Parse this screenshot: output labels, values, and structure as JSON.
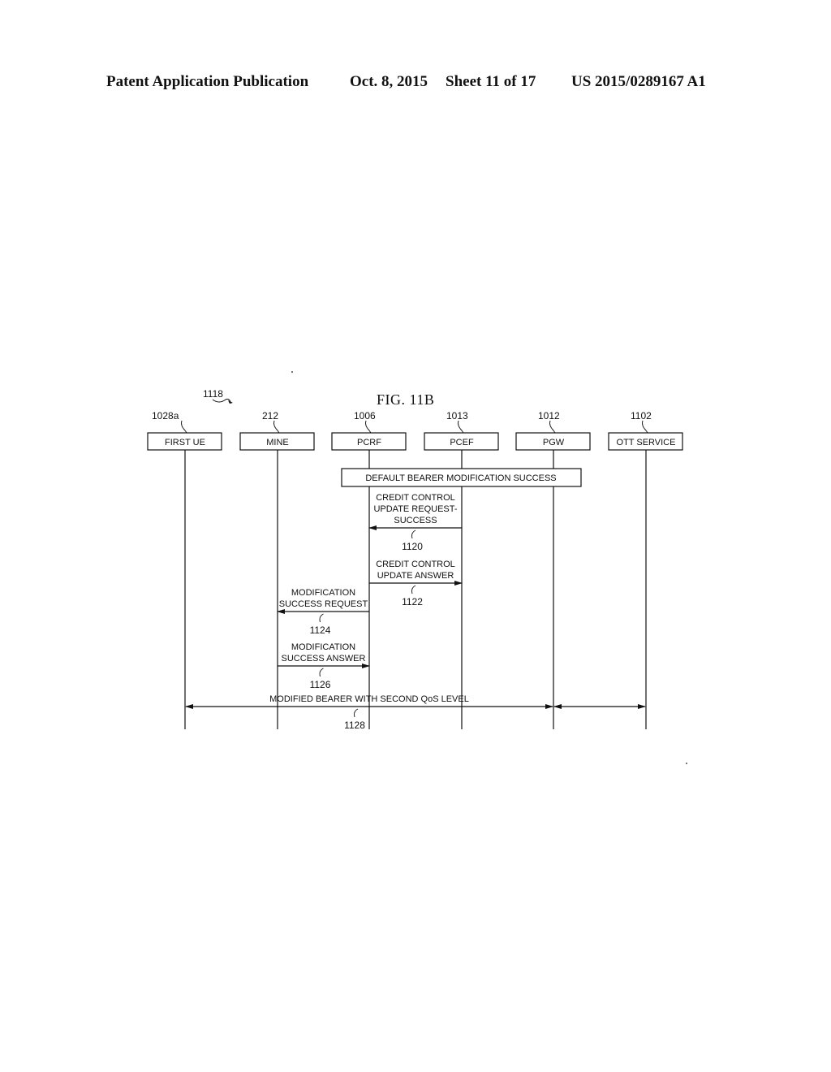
{
  "header": {
    "publication": "Patent Application Publication",
    "date": "Oct. 8, 2015",
    "sheet": "Sheet 11 of 17",
    "number": "US 2015/0289167 A1"
  },
  "figure": {
    "title": "FIG. 11B",
    "reference": "1118",
    "entities": [
      {
        "ref": "1028a",
        "label": "FIRST UE"
      },
      {
        "ref": "212",
        "label": "MINE"
      },
      {
        "ref": "1006",
        "label": "PCRF"
      },
      {
        "ref": "1013",
        "label": "PCEF"
      },
      {
        "ref": "1012",
        "label": "PGW"
      },
      {
        "ref": "1102",
        "label": "OTT SERVICE"
      }
    ],
    "span_box": {
      "label": "DEFAULT BEARER MODIFICATION SUCCESS",
      "from": 2,
      "to": 4
    },
    "messages": [
      {
        "ref": "1120",
        "lines": [
          "CREDIT CONTROL",
          "UPDATE REQUEST-",
          "SUCCESS"
        ],
        "from": 3,
        "to": 2
      },
      {
        "ref": "1122",
        "lines": [
          "CREDIT CONTROL",
          "UPDATE ANSWER"
        ],
        "from": 2,
        "to": 3
      },
      {
        "ref": "1124",
        "lines": [
          "MODIFICATION",
          "SUCCESS REQUEST"
        ],
        "from": 2,
        "to": 1
      },
      {
        "ref": "1126",
        "lines": [
          "MODIFICATION",
          "SUCCESS ANSWER"
        ],
        "from": 1,
        "to": 2
      },
      {
        "ref": "1128",
        "lines": [
          "MODIFIED BEARER WITH SECOND QoS LEVEL"
        ],
        "from": 0,
        "to": 4,
        "bidirectional": true,
        "extension_to": 5
      }
    ]
  }
}
